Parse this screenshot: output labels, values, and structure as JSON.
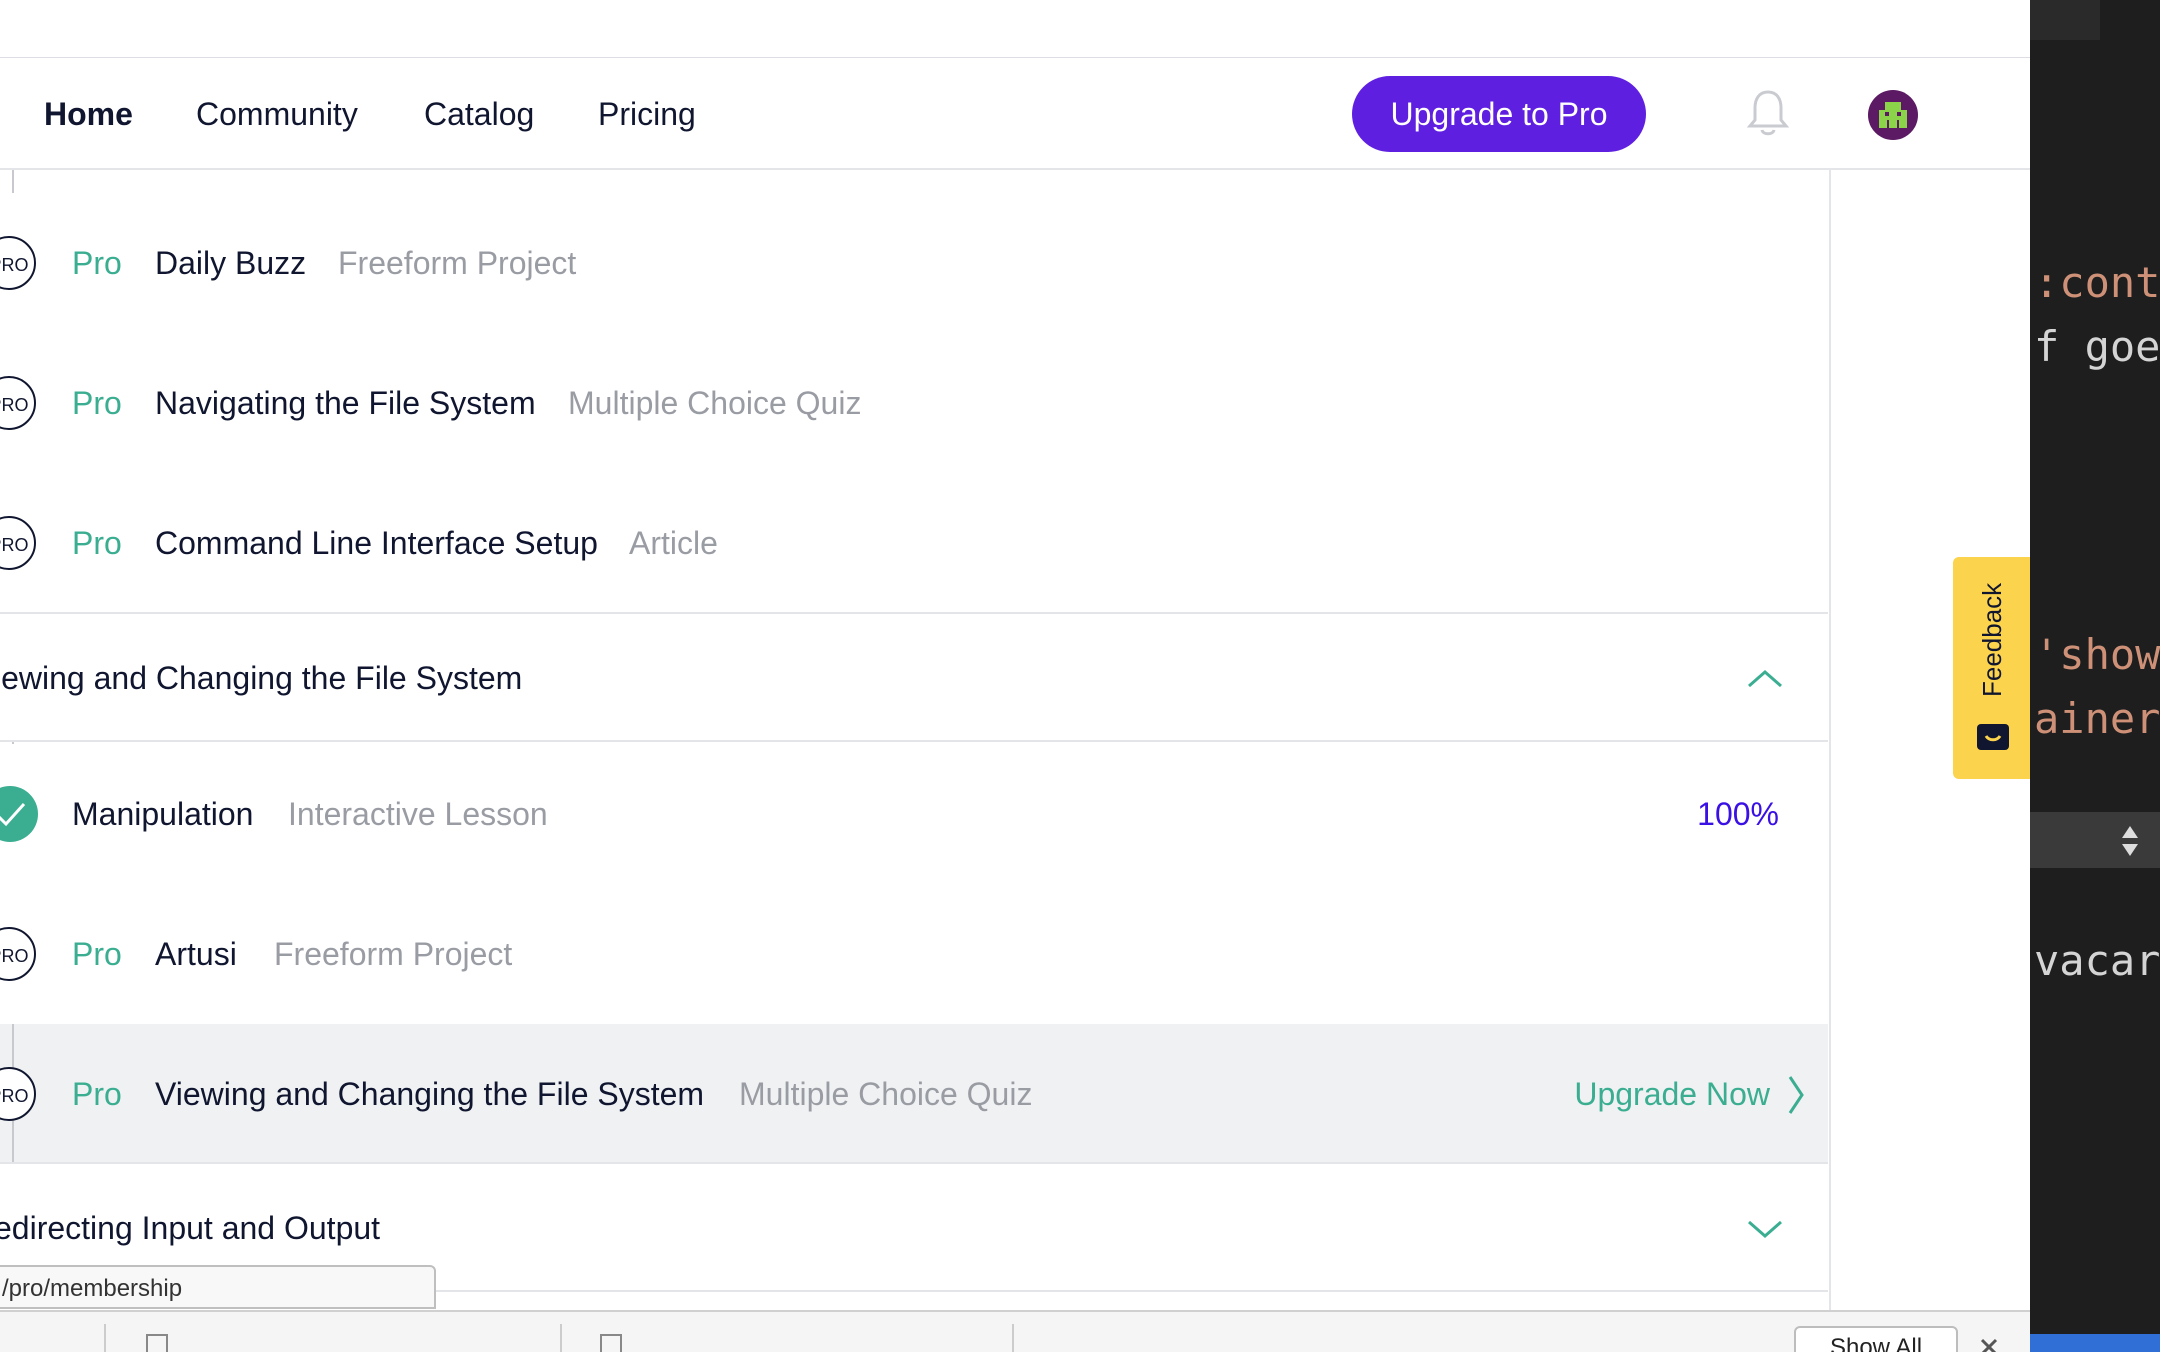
{
  "nav": {
    "links": [
      "Home",
      "Community",
      "Catalog",
      "Pricing"
    ],
    "upgrade_button": "Upgrade to Pro"
  },
  "items_top": [
    {
      "badge": "PRO",
      "tag": "Pro",
      "title": "Daily Buzz",
      "type": "Freeform Project"
    },
    {
      "badge": "PRO",
      "tag": "Pro",
      "title": "Navigating the File System",
      "type": "Multiple Choice Quiz"
    },
    {
      "badge": "PRO",
      "tag": "Pro",
      "title": "Command Line Interface Setup",
      "type": "Article"
    }
  ],
  "section1": {
    "title": "iewing and Changing the File System",
    "expanded": true
  },
  "items_section1": [
    {
      "title": "Manipulation",
      "type": "Interactive Lesson",
      "progress": "100%",
      "completed": true
    },
    {
      "badge": "PRO",
      "tag": "Pro",
      "title": "Artusi",
      "type": "Freeform Project"
    },
    {
      "badge": "PRO",
      "tag": "Pro",
      "title": "Viewing and Changing the File System",
      "type": "Multiple Choice Quiz",
      "cta": "Upgrade Now"
    }
  ],
  "section2": {
    "title": "edirecting Input and Output",
    "expanded": false
  },
  "status_url": "/pro/membership",
  "feedback_tab": "Feedback",
  "download_bar": {
    "show_all": "Show All"
  },
  "editor_code": [
    ":conta",
    "f goes",
    "'showc",
    "ainer",
    "vacara"
  ],
  "colors": {
    "accent": "#5f1fe0",
    "pro": "#3bae92",
    "progress": "#3a10e5",
    "feedback": "#fcd34d"
  }
}
